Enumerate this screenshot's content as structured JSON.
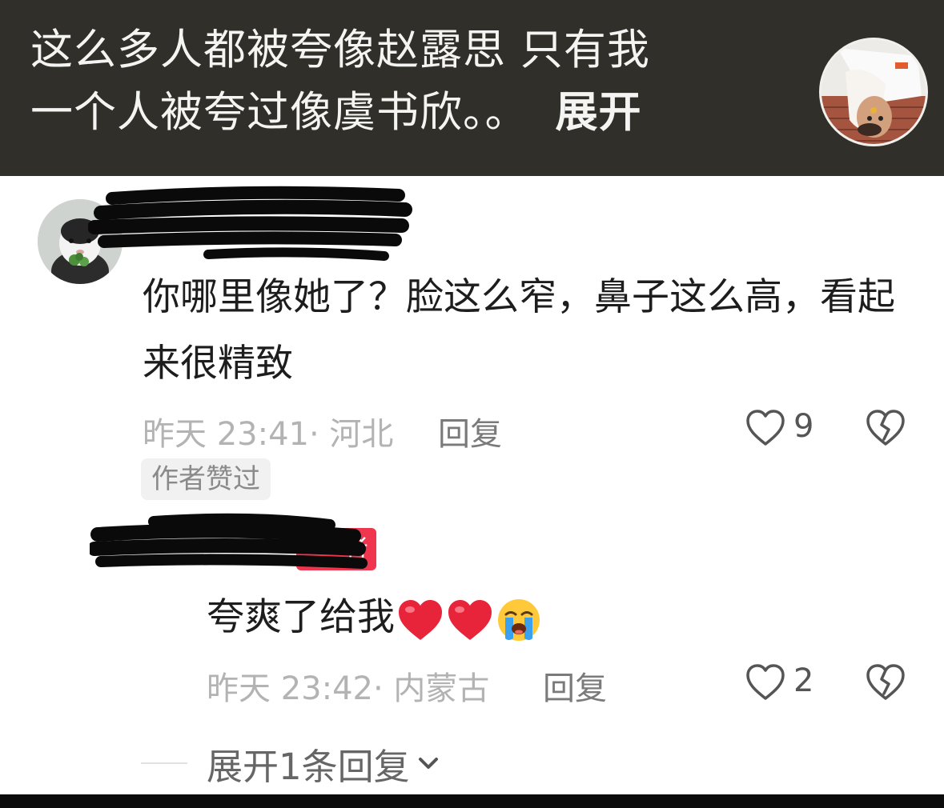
{
  "post": {
    "line1": "这么多人都被夸像赵露思 只有我",
    "line2": "一个人被夸过像虞书欣。。",
    "expand_label": "展开"
  },
  "comment": {
    "text": "你哪里像她了？脸这么窄，鼻子这么高，看起来很精致",
    "time_location": "昨天 23:41· 河北",
    "reply_label": "回复",
    "like_count": "9",
    "badge": "作者赞过"
  },
  "reply": {
    "author_tag": "者",
    "text": "夸爽了给我",
    "emojis": [
      "red-heart",
      "red-heart",
      "loudly-crying-face"
    ],
    "time_location": "昨天 23:42· 内蒙古",
    "reply_label": "回复",
    "like_count": "2"
  },
  "more_replies": {
    "label": "展开1条回复"
  },
  "colors": {
    "banner_bg": "#302f29",
    "author_tag": "#f0364f",
    "heart": "#e8243b"
  }
}
